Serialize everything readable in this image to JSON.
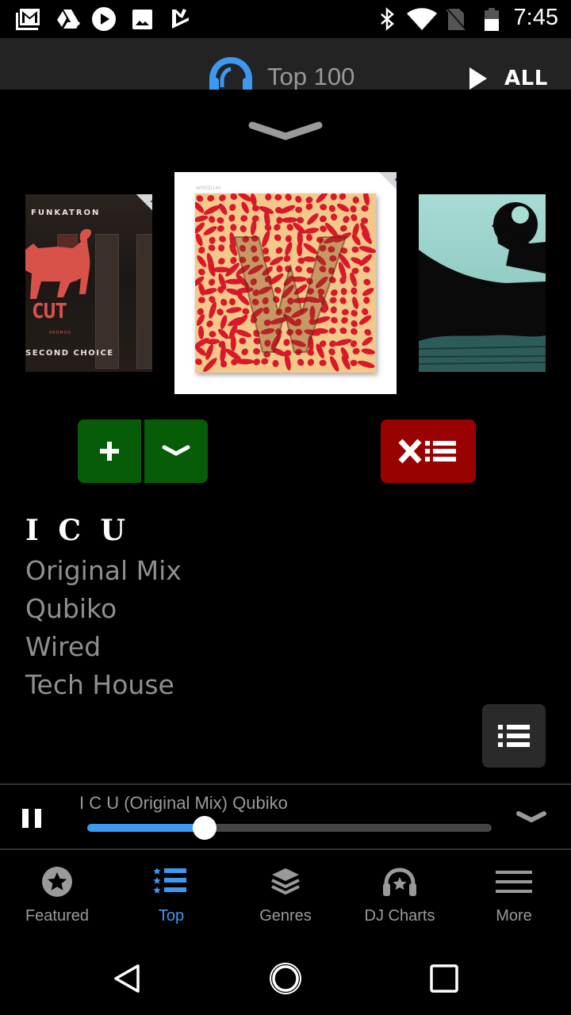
{
  "status_bar": {
    "time": "7:45",
    "left_icons": [
      "gmail-icon",
      "drive-icon",
      "play-icon",
      "photos-icon",
      "tasks-icon"
    ],
    "right_icons": [
      "bluetooth-icon",
      "wifi-icon",
      "no-sim-icon",
      "battery-icon"
    ]
  },
  "header": {
    "icon": "headphones-icon",
    "title": "Top 100",
    "play_all_label": "ALL",
    "accent_color": "#3d98f0"
  },
  "carousel": {
    "items": [
      {
        "position": "previous",
        "artist": "FUNKATRON",
        "title": "SECOND CHOICE",
        "label": "CUT",
        "label_sub": "PROMOS",
        "badge": "PROMO"
      },
      {
        "position": "current",
        "catalog": "WIRED140",
        "badge": "PROMO"
      },
      {
        "position": "next"
      }
    ]
  },
  "actions": {
    "add_icon": "plus-icon",
    "more_icon": "chevron-down-icon",
    "remove_icon": "remove-from-list-icon",
    "colors": {
      "green": "#075d07",
      "red": "#9a0202"
    }
  },
  "track": {
    "title": "I C U",
    "mix": "Original Mix",
    "artist": "Qubiko",
    "label": "Wired",
    "genre": "Tech House"
  },
  "player": {
    "now_playing": "I C U (Original Mix) Qubiko",
    "progress": 0.29,
    "state": "playing"
  },
  "tabs": [
    {
      "label": "Featured",
      "icon": "star-circle-icon",
      "active": false
    },
    {
      "label": "Top",
      "icon": "star-list-icon",
      "active": true
    },
    {
      "label": "Genres",
      "icon": "layers-icon",
      "active": false
    },
    {
      "label": "DJ Charts",
      "icon": "headphones-star-icon",
      "active": false
    },
    {
      "label": "More",
      "icon": "menu-icon",
      "active": false
    }
  ],
  "system_nav": [
    "back-icon",
    "home-icon",
    "recents-icon"
  ]
}
